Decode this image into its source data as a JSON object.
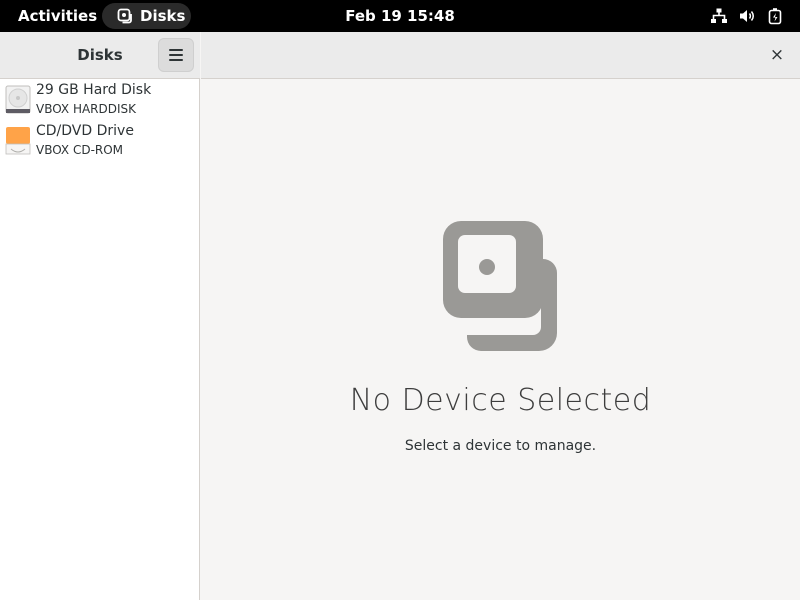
{
  "topbar": {
    "activities": "Activities",
    "app_name": "Disks",
    "clock": "Feb 19  15:48",
    "tray_icons": [
      "network-icon",
      "volume-icon",
      "battery-icon"
    ]
  },
  "sidebar": {
    "title": "Disks",
    "devices": [
      {
        "name": "29 GB Hard Disk",
        "model": "VBOX HARDDISK",
        "icon": "hard-disk-icon"
      },
      {
        "name": "CD/DVD Drive",
        "model": "VBOX CD-ROM",
        "icon": "optical-drive-icon"
      }
    ]
  },
  "main": {
    "empty_title": "No Device Selected",
    "empty_subtitle": "Select a device to manage.",
    "close_label": "×"
  },
  "colors": {
    "topbar_bg": "#000000",
    "window_bg": "#f6f5f4",
    "sidebar_bg": "#ffffff",
    "header_bg": "#ebebeb",
    "optical_accent": "#ffa348",
    "placeholder_icon": "#9a9996"
  }
}
